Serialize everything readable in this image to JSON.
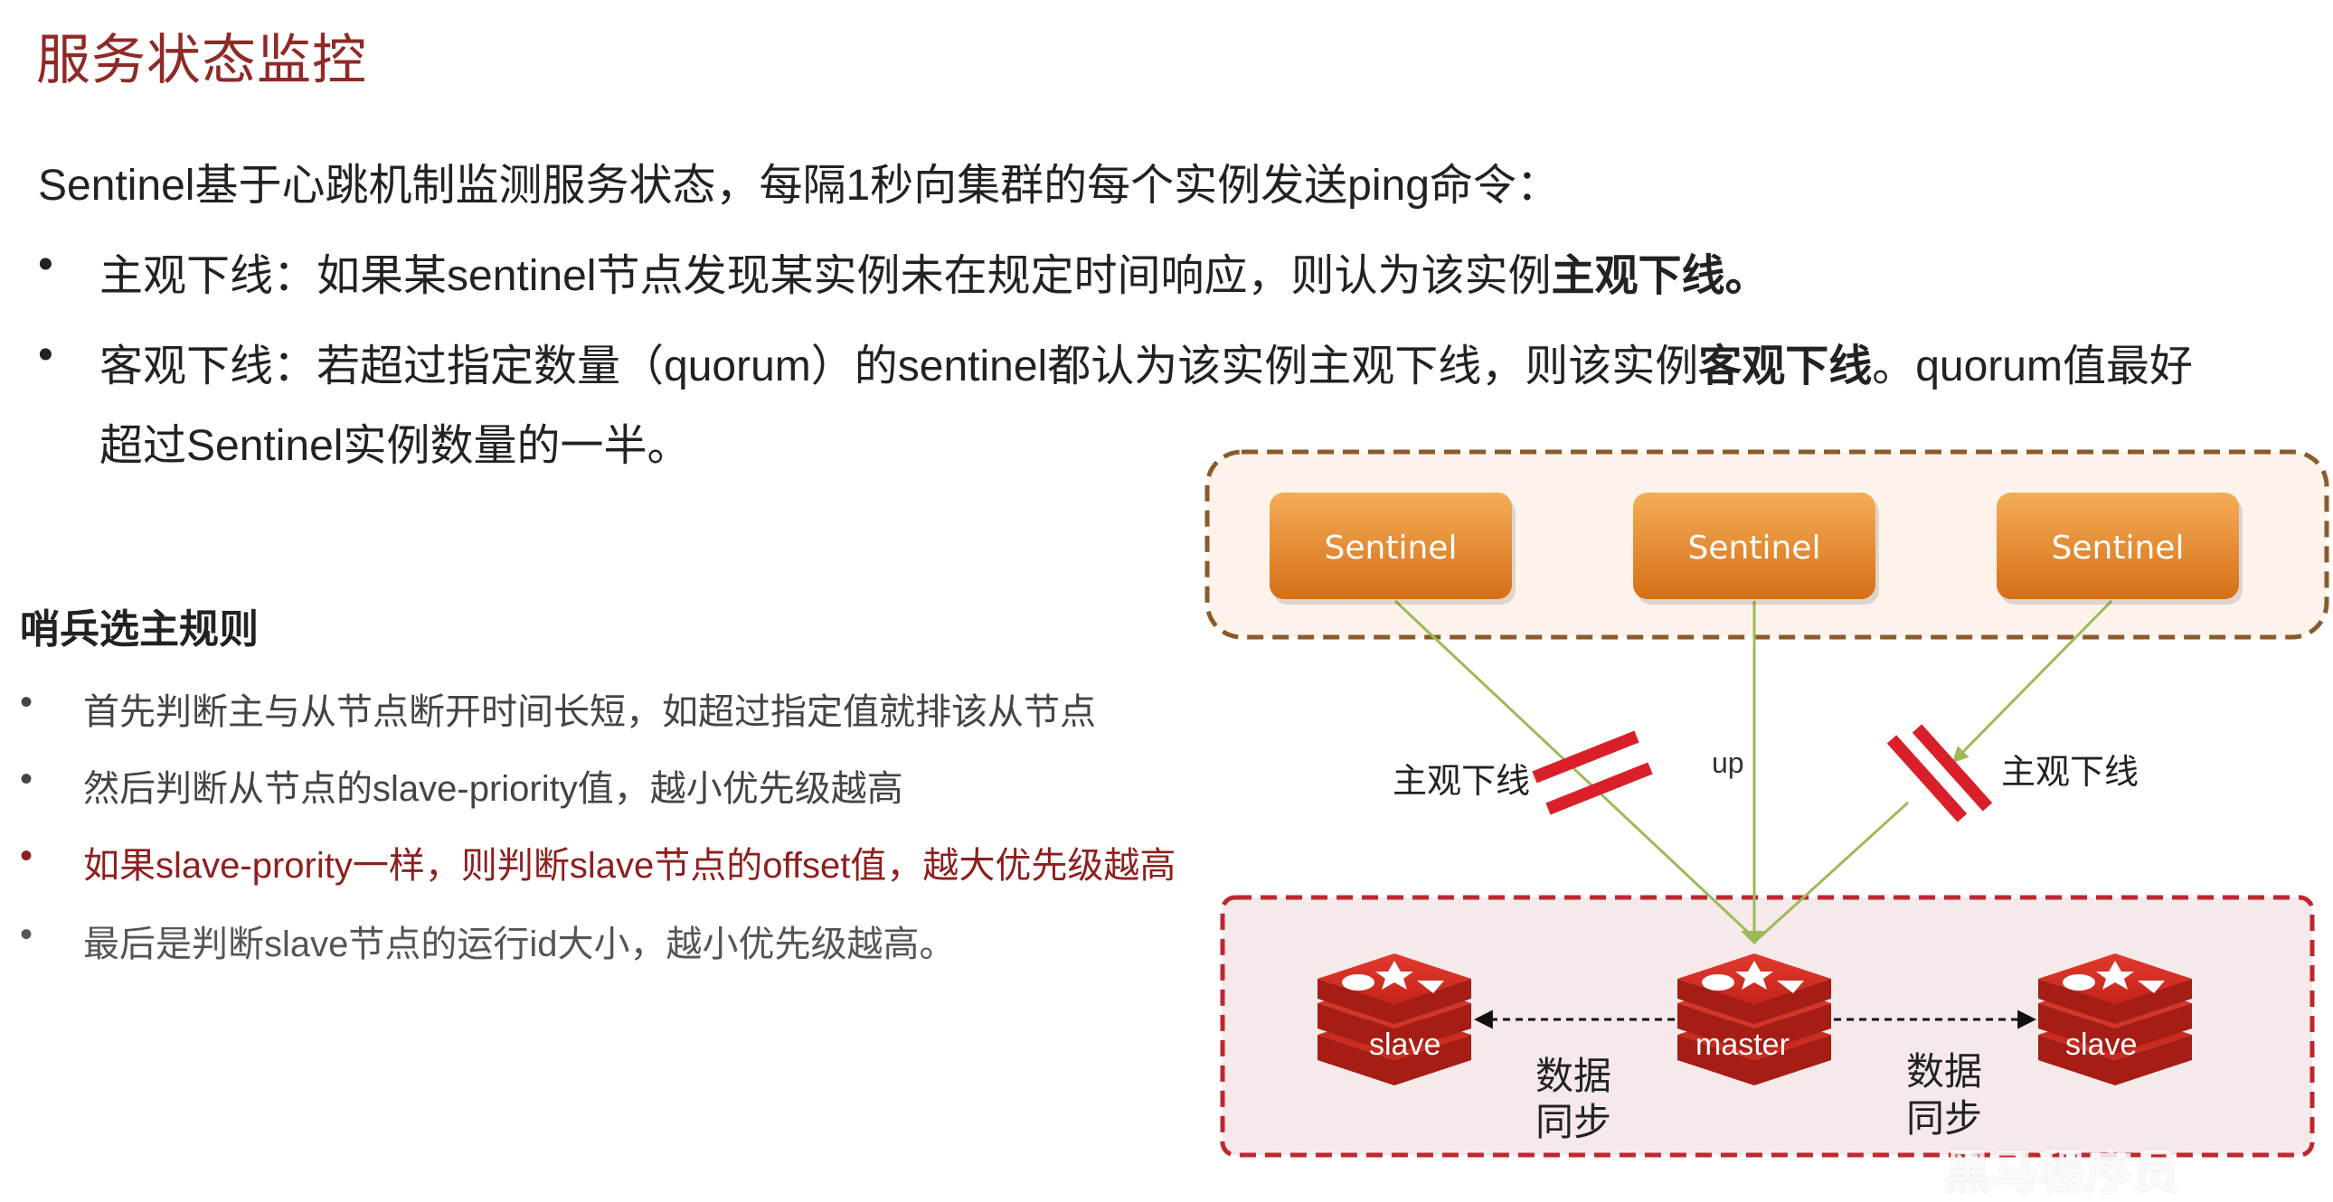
{
  "title": "服务状态监控",
  "intro": "Sentinel基于心跳机制监测服务状态，每隔1秒向集群的每个实例发送ping命令：",
  "bullets": [
    {
      "dot": "•",
      "prefix": "主观下线：如果某sentinel节点发现某实例未在规定时间响应，则认为该实例",
      "bold": "主观下线",
      "suffix": "。"
    },
    {
      "dot": "•",
      "prefix": "客观下线：若超过指定数量（quorum）的sentinel都认为该实例主观下线，则该实例",
      "bold": "客观下线",
      "suffix": "。quorum值最好",
      "line2": "超过Sentinel实例数量的一半。"
    }
  ],
  "election": {
    "title": "哨兵选主规则",
    "rules": [
      "首先判断主与从节点断开时间长短，如超过指定值就排该从节点",
      "然后判断从节点的slave-priority值，越小优先级越高",
      "如果slave-prority一样，则判断slave节点的offset值，越大优先级越高",
      "最后是判断slave节点的运行id大小，越小优先级越高。"
    ],
    "dot": "•"
  },
  "diagram": {
    "sentinels": [
      "Sentinel",
      "Sentinel",
      "Sentinel"
    ],
    "labels": {
      "left_down": "主观下线",
      "right_down": "主观下线",
      "up": "up",
      "sync_left_1": "数据",
      "sync_left_2": "同步",
      "sync_right_1": "数据",
      "sync_right_2": "同步"
    },
    "nodes": {
      "slave_left": "slave",
      "master": "master",
      "slave_right": "slave"
    }
  },
  "watermark": "黑马程序员",
  "colors": {
    "title": "#8e2a27",
    "sentinel_fill_top": "#f2a24a",
    "sentinel_fill_bottom": "#d8731a",
    "sentinel_box_border": "#8a5a2b",
    "sentinel_box_bg": "#fdf3ea",
    "redis_box_border": "#c0262f",
    "redis_box_bg": "#f6e7e8",
    "redis_red": "#d82c20",
    "line_green": "#9bbb59",
    "cut_red": "#d9202a",
    "highlight_text": "#8e1f1f"
  }
}
